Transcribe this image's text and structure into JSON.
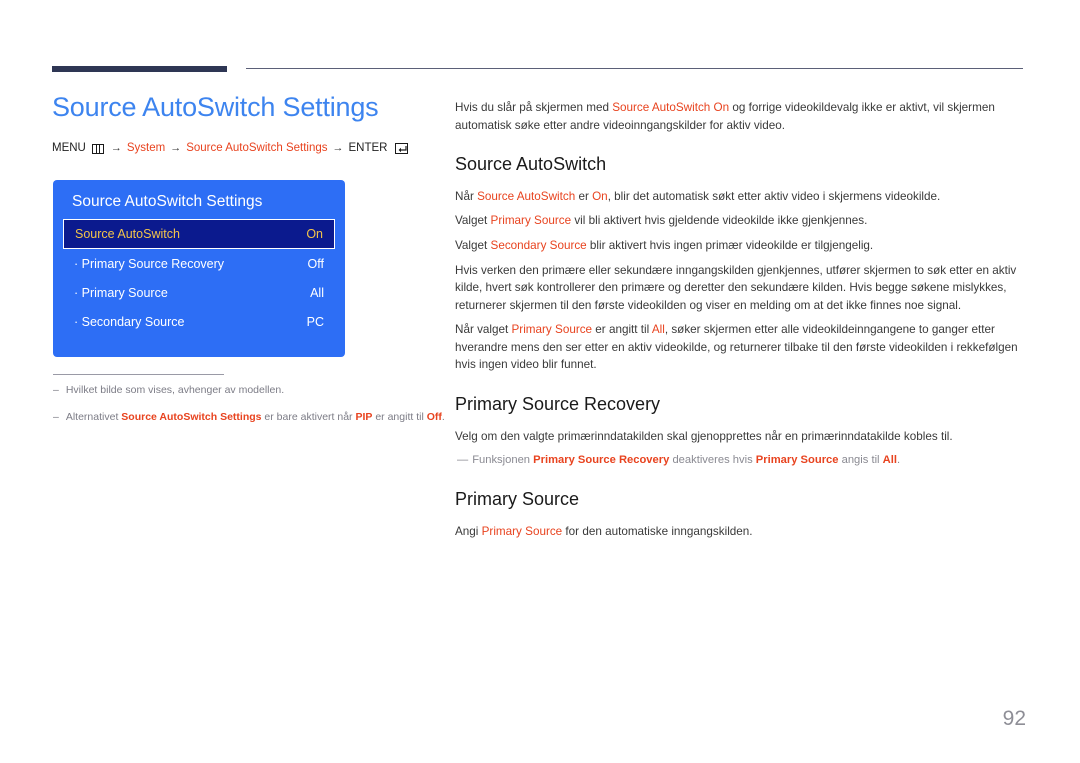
{
  "page": {
    "title": "Source AutoSwitch Settings",
    "number": "92",
    "accent_blue": "#3d84ef",
    "accent_red": "#e8431f",
    "rule_color": "#2e3654"
  },
  "breadcrumb": {
    "menu_label": "MENU",
    "menu_icon": "menu-grid-icon",
    "arrow": "→",
    "item1": "System",
    "item2": "Source AutoSwitch Settings",
    "enter_label": "ENTER",
    "enter_icon": "enter-return-icon"
  },
  "osd": {
    "title": "Source AutoSwitch Settings",
    "rows": [
      {
        "label": "Source AutoSwitch",
        "value": "On",
        "selected": true
      },
      {
        "label": "· Primary Source Recovery",
        "value": "Off",
        "selected": false
      },
      {
        "label": "· Primary Source",
        "value": "All",
        "selected": false
      },
      {
        "label": "· Secondary Source",
        "value": "PC",
        "selected": false
      }
    ],
    "panel_color": "#2d6ef5",
    "selected_bg": "#0b1a8e",
    "selected_text": "#f3c44a"
  },
  "footnotes": [
    {
      "dash": "–",
      "parts": [
        {
          "t": "Hvilket bilde som vises, avhenger av modellen.",
          "hl": false
        }
      ]
    },
    {
      "dash": "–",
      "parts": [
        {
          "t": "Alternativet ",
          "hl": false
        },
        {
          "t": "Source AutoSwitch Settings",
          "hl": true
        },
        {
          "t": " er bare aktivert når ",
          "hl": false
        },
        {
          "t": "PIP",
          "hl": true
        },
        {
          "t": " er angitt til ",
          "hl": false
        },
        {
          "t": "Off",
          "hl": true
        },
        {
          "t": ".",
          "hl": false
        }
      ]
    }
  ],
  "content": {
    "intro": [
      {
        "t": "Hvis du slår på skjermen med ",
        "hl": false
      },
      {
        "t": "Source AutoSwitch On",
        "hl": true
      },
      {
        "t": " og forrige videokildevalg ikke er aktivt, vil skjermen automatisk søke etter andre videoinngangskilder for aktiv video.",
        "hl": false
      }
    ],
    "sections": [
      {
        "heading": "Source AutoSwitch",
        "paragraphs": [
          [
            {
              "t": "Når ",
              "hl": false
            },
            {
              "t": "Source AutoSwitch",
              "hl": true
            },
            {
              "t": " er ",
              "hl": false
            },
            {
              "t": "On",
              "hl": true
            },
            {
              "t": ", blir det automatisk søkt etter aktiv video i skjermens videokilde.",
              "hl": false
            }
          ],
          [
            {
              "t": "Valget ",
              "hl": false
            },
            {
              "t": "Primary Source",
              "hl": true
            },
            {
              "t": " vil bli aktivert hvis gjeldende videokilde ikke gjenkjennes.",
              "hl": false
            }
          ],
          [
            {
              "t": "Valget ",
              "hl": false
            },
            {
              "t": "Secondary Source",
              "hl": true
            },
            {
              "t": " blir aktivert hvis ingen primær videokilde er tilgjengelig.",
              "hl": false
            }
          ],
          [
            {
              "t": "Hvis verken den primære eller sekundære inngangskilden gjenkjennes, utfører skjermen to søk etter en aktiv kilde, hvert søk kontrollerer den primære og deretter den sekundære kilden. Hvis begge søkene mislykkes, returnerer skjermen til den første videokilden og viser en melding om at det ikke finnes noe signal.",
              "hl": false
            }
          ],
          [
            {
              "t": "Når valget ",
              "hl": false
            },
            {
              "t": "Primary Source",
              "hl": true
            },
            {
              "t": " er angitt til ",
              "hl": false
            },
            {
              "t": "All",
              "hl": true
            },
            {
              "t": ", søker skjermen etter alle videokildeinngangene to ganger etter hverandre mens den ser etter en aktiv videokilde, og returnerer tilbake til den første videokilden i rekkefølgen hvis ingen video blir funnet.",
              "hl": false
            }
          ]
        ],
        "note": null
      },
      {
        "heading": "Primary Source Recovery",
        "paragraphs": [
          [
            {
              "t": "Velg om den valgte primærinndatakilden skal gjenopprettes når en primærinndatakilde kobles til.",
              "hl": false
            }
          ]
        ],
        "note": {
          "dash": "—",
          "parts": [
            {
              "t": "Funksjonen ",
              "hl": false
            },
            {
              "t": "Primary Source Recovery",
              "hl": true
            },
            {
              "t": " deaktiveres hvis ",
              "hl": false
            },
            {
              "t": "Primary Source",
              "hl": true
            },
            {
              "t": " angis til ",
              "hl": false
            },
            {
              "t": "All",
              "hl": true
            },
            {
              "t": ".",
              "hl": false
            }
          ]
        }
      },
      {
        "heading": "Primary Source",
        "paragraphs": [
          [
            {
              "t": "Angi ",
              "hl": false
            },
            {
              "t": "Primary Source",
              "hl": true
            },
            {
              "t": " for den automatiske inngangskilden.",
              "hl": false
            }
          ]
        ],
        "note": null
      }
    ]
  }
}
